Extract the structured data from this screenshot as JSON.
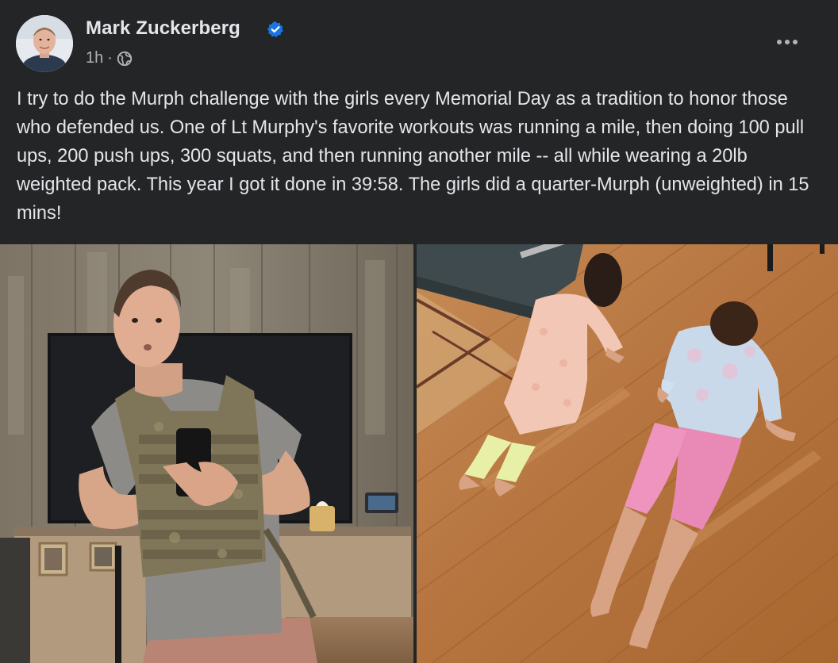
{
  "post": {
    "author": {
      "name": "Mark Zuckerberg",
      "verified": true,
      "avatar_icon": "profile-photo"
    },
    "meta": {
      "time": "1h",
      "separator": "·",
      "audience_icon": "globe-icon"
    },
    "more_icon": "more-options-icon",
    "text": "I try to do the Murph challenge with the girls every Memorial Day as a tradition to honor those who defended us. One of Lt Murphy's favorite workouts was running a mile, then doing 100 pull ups, 200 push ups, 300 squats, and then running another mile -- all while wearing a 20lb weighted pack. This year I got it done in 39:58. The girls did a quarter-Murph (unweighted) in 15 mins!",
    "photos": [
      {
        "name": "man-weighted-vest-selfie-photo"
      },
      {
        "name": "girls-doing-push-ups-photo"
      }
    ]
  },
  "colors": {
    "background": "#242526",
    "primary_text": "#e4e6eb",
    "secondary_text": "#b0b3b8",
    "verified_badge": "#1b74e4"
  }
}
